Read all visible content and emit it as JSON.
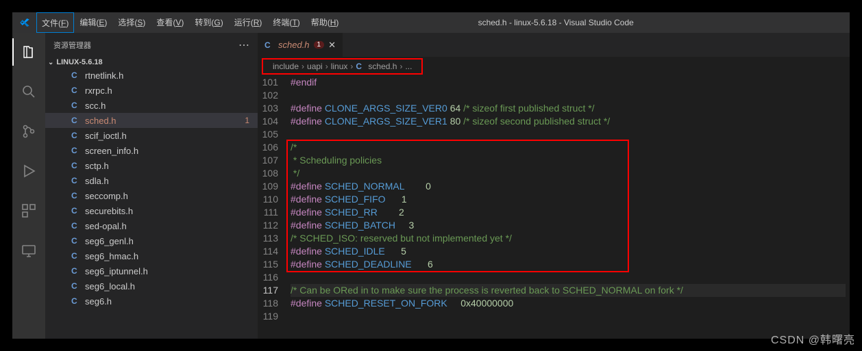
{
  "window": {
    "title": "sched.h - linux-5.6.18 - Visual Studio Code"
  },
  "menu": {
    "items": [
      {
        "label": "文件",
        "key": "F"
      },
      {
        "label": "编辑",
        "key": "E"
      },
      {
        "label": "选择",
        "key": "S"
      },
      {
        "label": "查看",
        "key": "V"
      },
      {
        "label": "转到",
        "key": "G"
      },
      {
        "label": "运行",
        "key": "R"
      },
      {
        "label": "终端",
        "key": "T"
      },
      {
        "label": "帮助",
        "key": "H"
      }
    ]
  },
  "sidebar": {
    "title": "资源管理器",
    "section": "LINUX-5.6.18",
    "files": [
      "rtnetlink.h",
      "rxrpc.h",
      "scc.h",
      "sched.h",
      "scif_ioctl.h",
      "screen_info.h",
      "sctp.h",
      "sdla.h",
      "seccomp.h",
      "securebits.h",
      "sed-opal.h",
      "seg6_genl.h",
      "seg6_hmac.h",
      "seg6_iptunnel.h",
      "seg6_local.h",
      "seg6.h"
    ],
    "selected": "sched.h",
    "selectedBadge": "1"
  },
  "tab": {
    "file": "sched.h",
    "errors": "1"
  },
  "breadcrumb": {
    "parts": [
      "include",
      "uapi",
      "linux"
    ],
    "file": "sched.h",
    "tail": "..."
  },
  "code": {
    "startLine": 101,
    "currentLine": 117,
    "raw": [
      [
        [
          "kw",
          "#endif"
        ]
      ],
      [],
      [
        [
          "kw",
          "#define "
        ],
        [
          "mac",
          "CLONE_ARGS_SIZE_VER0"
        ],
        [
          "",
          " "
        ],
        [
          "num",
          "64"
        ],
        [
          "",
          " "
        ],
        [
          "cmt",
          "/* sizeof first published struct */"
        ]
      ],
      [
        [
          "kw",
          "#define "
        ],
        [
          "mac",
          "CLONE_ARGS_SIZE_VER1"
        ],
        [
          "",
          " "
        ],
        [
          "num",
          "80"
        ],
        [
          "",
          " "
        ],
        [
          "cmt",
          "/* sizeof second published struct */"
        ]
      ],
      [],
      [
        [
          "cmt",
          "/*"
        ]
      ],
      [
        [
          "cmt",
          " * Scheduling policies"
        ]
      ],
      [
        [
          "cmt",
          " */"
        ]
      ],
      [
        [
          "kw",
          "#define "
        ],
        [
          "mac",
          "SCHED_NORMAL"
        ],
        [
          "",
          "        "
        ],
        [
          "num",
          "0"
        ]
      ],
      [
        [
          "kw",
          "#define "
        ],
        [
          "mac",
          "SCHED_FIFO"
        ],
        [
          "",
          "      "
        ],
        [
          "num",
          "1"
        ]
      ],
      [
        [
          "kw",
          "#define "
        ],
        [
          "mac",
          "SCHED_RR"
        ],
        [
          "",
          "        "
        ],
        [
          "num",
          "2"
        ]
      ],
      [
        [
          "kw",
          "#define "
        ],
        [
          "mac",
          "SCHED_BATCH"
        ],
        [
          "",
          "     "
        ],
        [
          "num",
          "3"
        ]
      ],
      [
        [
          "cmt",
          "/* SCHED_ISO: reserved but not implemented yet */"
        ]
      ],
      [
        [
          "kw",
          "#define "
        ],
        [
          "mac",
          "SCHED_IDLE"
        ],
        [
          "",
          "      "
        ],
        [
          "num",
          "5"
        ]
      ],
      [
        [
          "kw",
          "#define "
        ],
        [
          "mac",
          "SCHED_DEADLINE"
        ],
        [
          "",
          "      "
        ],
        [
          "num",
          "6"
        ]
      ],
      [],
      [
        [
          "cmt",
          "/* Can be ORed in to make sure the process is reverted back to SCHED_NORMAL on fork */"
        ]
      ],
      [
        [
          "kw",
          "#define "
        ],
        [
          "mac",
          "SCHED_RESET_ON_FORK"
        ],
        [
          "",
          "     "
        ],
        [
          "num",
          "0x40000000"
        ]
      ],
      []
    ]
  },
  "watermark": "CSDN @韩曙亮"
}
